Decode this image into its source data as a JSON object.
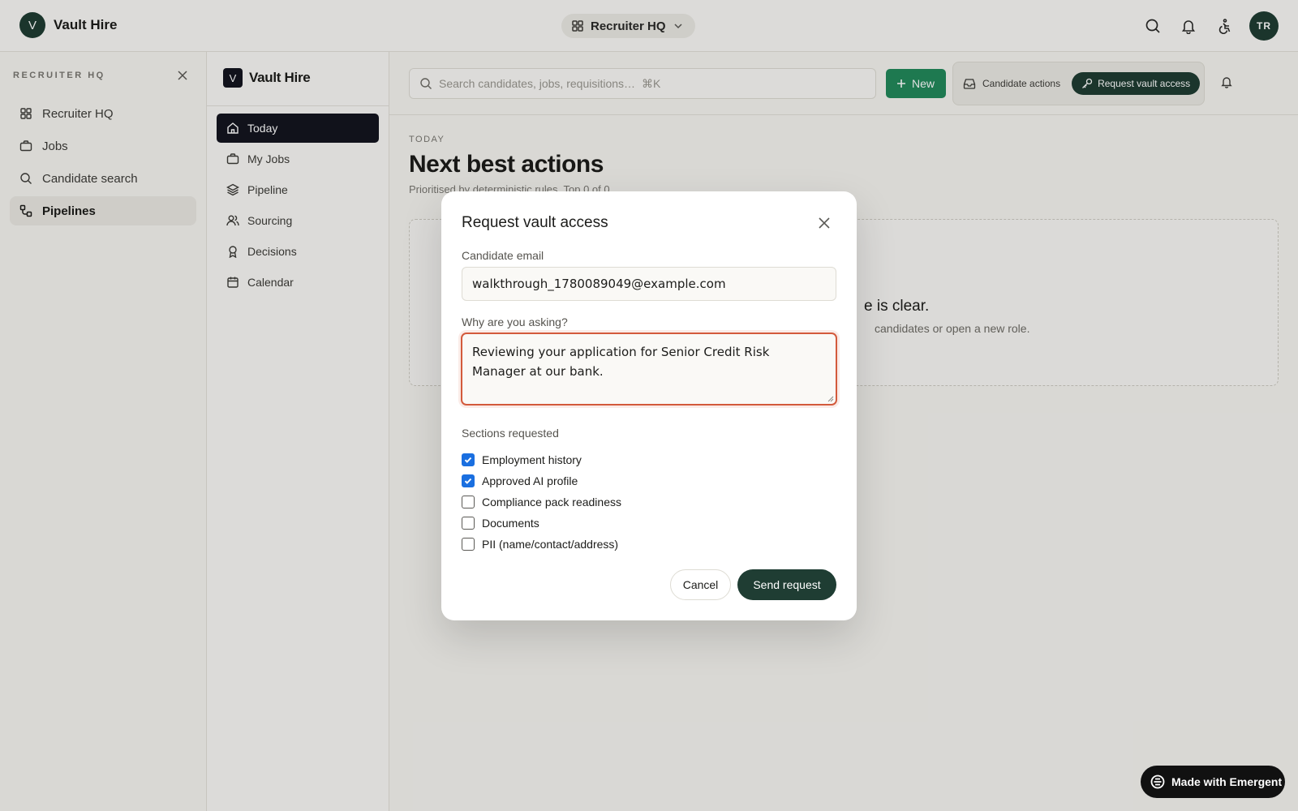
{
  "topbar": {
    "brand_initial": "V",
    "brand_name": "Vault Hire",
    "workspace": "Recruiter HQ",
    "avatar_initials": "TR"
  },
  "sidebar": {
    "title": "RECRUITER HQ",
    "items": [
      {
        "label": "Recruiter HQ",
        "icon": "dashboard-icon"
      },
      {
        "label": "Jobs",
        "icon": "briefcase-icon"
      },
      {
        "label": "Candidate search",
        "icon": "search-icon"
      },
      {
        "label": "Pipelines",
        "icon": "pipeline-icon",
        "active": true
      }
    ]
  },
  "nav2": {
    "brand_initial": "V",
    "brand_name": "Vault Hire",
    "items": [
      {
        "label": "Today",
        "icon": "home-icon",
        "active": true
      },
      {
        "label": "My Jobs",
        "icon": "briefcase-icon"
      },
      {
        "label": "Pipeline",
        "icon": "layers-icon"
      },
      {
        "label": "Sourcing",
        "icon": "users-icon"
      },
      {
        "label": "Decisions",
        "icon": "award-icon"
      },
      {
        "label": "Calendar",
        "icon": "calendar-icon"
      }
    ]
  },
  "main": {
    "search_placeholder": "Search candidates, jobs, requisitions…",
    "search_shortcut": "⌘K",
    "new_label": "New",
    "candidate_actions_label": "Candidate actions",
    "vault_button_label": "Request vault access",
    "eyebrow": "TODAY",
    "title": "Next best actions",
    "subtitle": "Prioritised by deterministic rules. Top 0 of 0.",
    "empty_title": "e is clear.",
    "empty_sub": "candidates or open a new role."
  },
  "modal": {
    "title": "Request vault access",
    "email_label": "Candidate email",
    "email_value": "walkthrough_1780089049@example.com",
    "reason_label": "Why are you asking?",
    "reason_value": "Reviewing your application for Senior Credit Risk Manager at our bank.",
    "sections_label": "Sections requested",
    "sections": [
      {
        "label": "Employment history",
        "checked": true
      },
      {
        "label": "Approved AI profile",
        "checked": true
      },
      {
        "label": "Compliance pack readiness",
        "checked": false
      },
      {
        "label": "Documents",
        "checked": false
      },
      {
        "label": "PII (name/contact/address)",
        "checked": false
      }
    ],
    "cancel_label": "Cancel",
    "send_label": "Send request"
  },
  "badge": {
    "label": "Made with Emergent"
  },
  "colors": {
    "brand_dark_green": "#1f3d33",
    "new_button_green": "#238a5c",
    "focus_ring": "#d35a3c",
    "checkbox_blue": "#1a6fe0",
    "nav_active": "#14151f"
  }
}
